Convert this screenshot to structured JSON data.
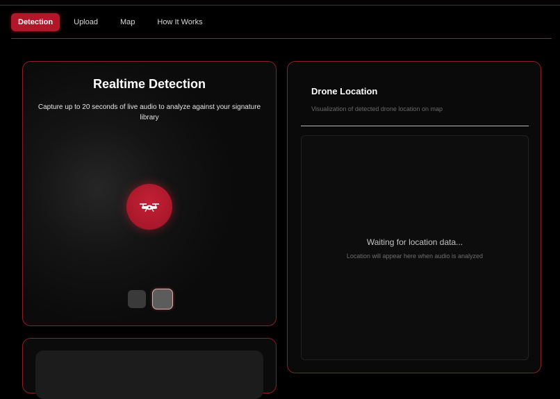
{
  "nav": {
    "items": [
      {
        "label": "Detection",
        "active": true
      },
      {
        "label": "Upload",
        "active": false
      },
      {
        "label": "Map",
        "active": false
      },
      {
        "label": "How It Works",
        "active": false
      }
    ]
  },
  "detection": {
    "title": "Realtime Detection",
    "subtitle": "Capture up to 20 seconds of live audio to analyze against your signature library",
    "record_icon": "drone-icon"
  },
  "map_panel": {
    "title": "Drone Location",
    "subtitle": "Visualization of detected drone location on map",
    "waiting_text": "Waiting for location data...",
    "hint_text": "Location will appear here when audio is analyzed"
  },
  "colors": {
    "accent": "#b0182a",
    "border": "#8c1f27",
    "background": "#000000"
  }
}
